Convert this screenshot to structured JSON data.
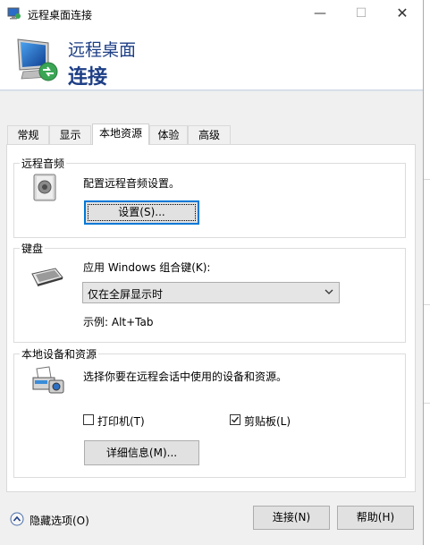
{
  "window": {
    "title": "远程桌面连接",
    "controls": {
      "minimize": "—",
      "maximize": "☐",
      "close": "✕"
    }
  },
  "banner": {
    "line1": "远程桌面",
    "line2": "连接"
  },
  "tabs": [
    {
      "label": "常规",
      "active": false
    },
    {
      "label": "显示",
      "active": false
    },
    {
      "label": "本地资源",
      "active": true
    },
    {
      "label": "体验",
      "active": false
    },
    {
      "label": "高级",
      "active": false
    }
  ],
  "audio": {
    "title": "远程音频",
    "description": "配置远程音频设置。",
    "settings_button": "设置(S)..."
  },
  "keyboard": {
    "title": "键盘",
    "description": "应用 Windows 组合键(K):",
    "selected_option": "仅在全屏显示时",
    "example": "示例: Alt+Tab"
  },
  "local_devices": {
    "title": "本地设备和资源",
    "description": "选择你要在远程会话中使用的设备和资源。",
    "printer_label": "打印机(T)",
    "printer_checked": false,
    "clipboard_label": "剪贴板(L)",
    "clipboard_checked": true,
    "details_button": "详细信息(M)..."
  },
  "footer": {
    "hide_options": "隐藏选项(O)",
    "connect_button": "连接(N)",
    "help_button": "帮助(H)"
  },
  "colors": {
    "accent": "#0078d7",
    "banner_text": "#1e3f86",
    "window_bg": "#f0f0f0"
  }
}
